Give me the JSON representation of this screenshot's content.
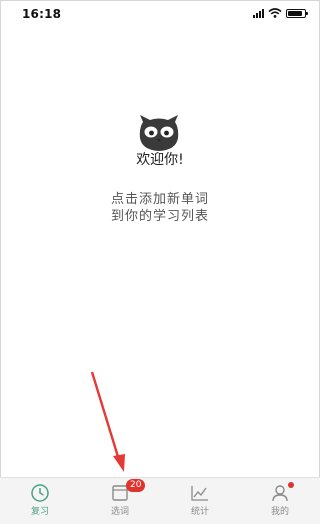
{
  "status": {
    "time": "16:18"
  },
  "main": {
    "welcome": "欢迎你!",
    "hint_line1": "点击添加新单词",
    "hint_line2": "到你的学习列表"
  },
  "tabbar": {
    "tabs": [
      {
        "label": "复习",
        "icon": "clock-icon",
        "active": true
      },
      {
        "label": "选词",
        "icon": "book-icon",
        "badge": "20"
      },
      {
        "label": "统计",
        "icon": "chart-icon"
      },
      {
        "label": "我的",
        "icon": "user-icon",
        "dot": true
      }
    ]
  },
  "colors": {
    "accent": "#4aa382",
    "badge": "#e0322f",
    "arrow": "#e53935"
  }
}
